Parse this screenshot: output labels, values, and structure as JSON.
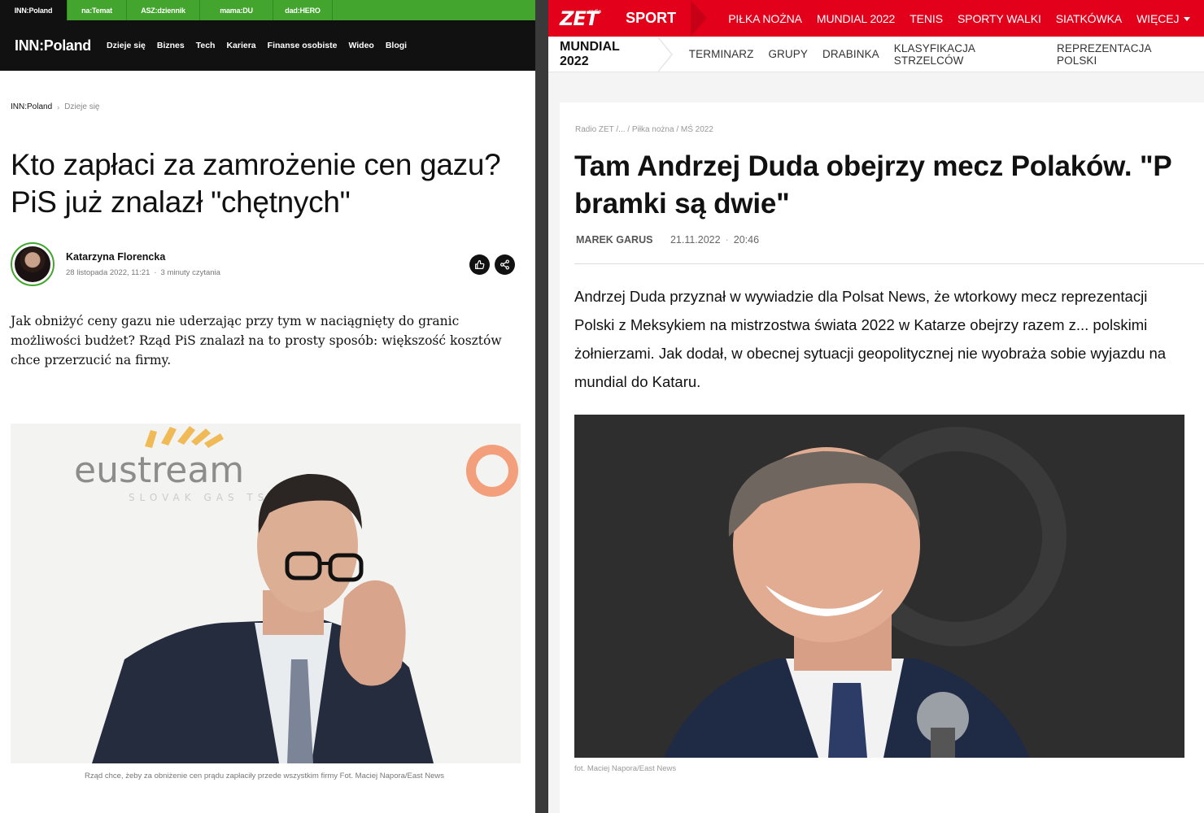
{
  "left": {
    "topbar": {
      "tabs": [
        "INN:Poland",
        "na:Temat",
        "ASZ:dziennik",
        "mama:DU",
        "dad:HERO"
      ]
    },
    "logo": "INN:Poland",
    "nav": [
      "Dzieje się",
      "Biznes",
      "Tech",
      "Kariera",
      "Finanse osobiste",
      "Wideo",
      "Blogi"
    ],
    "breadcrumb": {
      "home": "INN:Poland",
      "separator": "›",
      "current": "Dzieje się"
    },
    "title": "Kto zapłaci za zamrożenie cen gazu? PiS już znalazł \"chętnych\"",
    "author": {
      "name": "Katarzyna Florencka",
      "date": "28 listopada 2022, 11:21",
      "separator": "·",
      "read_time": "3 minuty czytania"
    },
    "actions": {
      "like_icon": "thumbs-up-icon",
      "share_icon": "share-icon"
    },
    "lead": "Jak obniżyć ceny gazu nie uderzając przy tym w naciągnięty do granic możliwości budżet? Rząd PiS znalazł na to prosty sposób: większość kosztów chce przerzucić na firmy.",
    "photo": {
      "logo_text": "eustream",
      "logo_subtext": "SLOVAK GAS TSO"
    },
    "caption": "Rząd chce, żeby za obniżenie cen prądu zapłaciły przede wszystkim firmy Fot. Maciej Napora/East News",
    "accent_color": "#43a52e"
  },
  "right": {
    "brand": {
      "logo": "ZET",
      "logo_small": "radio",
      "section": "SPORT"
    },
    "nav": [
      "PIŁKA NOŻNA",
      "MUNDIAL 2022",
      "TENIS",
      "SPORTY WALKI",
      "SIATKÓWKA",
      "WIĘCEJ"
    ],
    "subnav": {
      "section": "MUNDIAL 2022",
      "items": [
        "TERMINARZ",
        "GRUPY",
        "DRABINKA",
        "KLASYFIKACJA STRZELCÓW",
        "REPREZENTACJA POLSKI"
      ]
    },
    "breadcrumb": "Radio ZET /... / Piłka nożna / MŚ 2022",
    "title_line1": "Tam Andrzej Duda obejrzy mecz Polaków. \"P",
    "title_line2": "bramki są dwie\"",
    "meta": {
      "author": "MAREK GARUS",
      "date": "21.11.2022",
      "separator": "·",
      "time": "20:46"
    },
    "lead": "Andrzej Duda przyznał w wywiadzie dla Polsat News, że wtorkowy mecz reprezentacji Polski z Meksykiem na mistrzostwa świata 2022 w Katarze obejrzy razem z... polskimi żołnierzami. Jak dodał, w obecnej sytuacji geopolitycznej nie wyobraża sobie wyjazdu na mundial do Kataru.",
    "caption": "fot. Maciej Napora/East News",
    "accent_color": "#e3001b"
  }
}
